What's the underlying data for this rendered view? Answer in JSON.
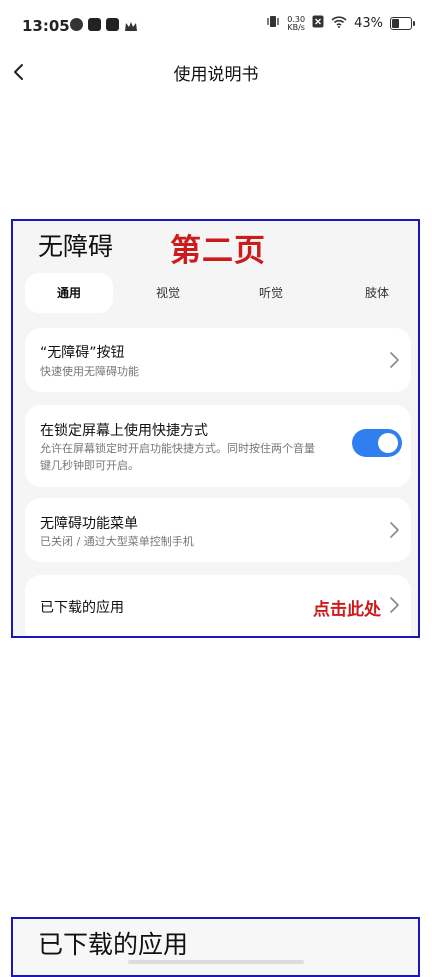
{
  "status_bar": {
    "time": "13:05",
    "net_speed_value": "0.30",
    "net_speed_unit": "KB/s",
    "battery": "43%",
    "battery_level": 0.43
  },
  "nav": {
    "title": "使用说明书"
  },
  "page": {
    "heading": "无障碍",
    "annotation": "第二页",
    "tabs": [
      {
        "label": "通用",
        "active": true
      },
      {
        "label": "视觉",
        "active": false
      },
      {
        "label": "听觉",
        "active": false
      },
      {
        "label": "肢体",
        "active": false
      }
    ],
    "items": [
      {
        "title": "“无障碍”按钮",
        "subtitle": "快速使用无障碍功能"
      },
      {
        "title": "在锁定屏幕上使用快捷方式",
        "subtitle_line1": "允许在屏幕锁定时开启功能快捷方式。同时按住两个音量",
        "subtitle_line2": "键几秒钟即可开启。",
        "toggle_on": true
      },
      {
        "title": "无障碍功能菜单",
        "subtitle": "已关闭 / 通过大型菜单控制手机"
      },
      {
        "title": "已下载的应用",
        "annotation": "点击此处"
      }
    ]
  },
  "next_page": {
    "heading": "已下载的应用"
  },
  "colors": {
    "frame_border": "#1a17b8",
    "annotation": "#cc1b1b",
    "toggle": "#2f7ff0"
  }
}
